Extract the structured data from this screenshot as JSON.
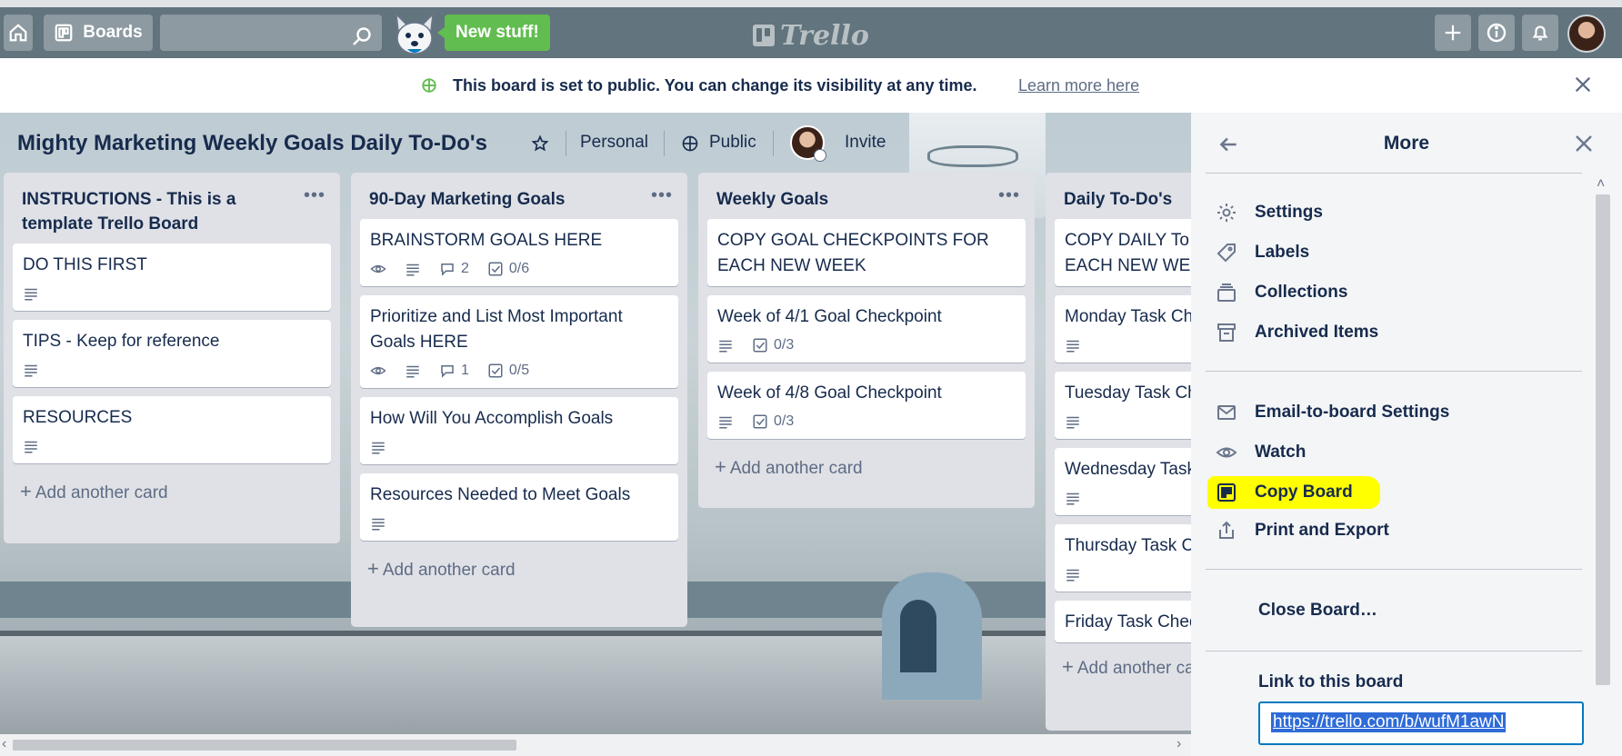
{
  "header": {
    "boards_label": "Boards",
    "search_placeholder": "",
    "new_stuff_label": "New stuff!",
    "logo_text": "Trello"
  },
  "banner": {
    "message": "This board is set to public. You can change its visibility at any time.",
    "learn_more": "Learn more here"
  },
  "board": {
    "title": "Mighty Marketing Weekly Goals Daily To-Do's",
    "team": "Personal",
    "visibility": "Public",
    "invite_label": "Invite"
  },
  "lists": [
    {
      "title": "INSTRUCTIONS - This is a template Trello Board",
      "cards": [
        {
          "title": "DO THIS FIRST"
        },
        {
          "title": "TIPS - Keep for reference"
        },
        {
          "title": "RESOURCES"
        }
      ],
      "add_label": "Add another card"
    },
    {
      "title": "90-Day Marketing Goals",
      "cards": [
        {
          "title": "BRAINSTORM GOALS HERE",
          "comments": "2",
          "checklist": "0/6"
        },
        {
          "title": "Prioritize and List Most Important Goals HERE",
          "comments": "1",
          "checklist": "0/5"
        },
        {
          "title": "How Will You Accomplish Goals"
        },
        {
          "title": "Resources Needed to Meet Goals"
        }
      ],
      "add_label": "Add another card"
    },
    {
      "title": "Weekly Goals",
      "cards": [
        {
          "title": "COPY GOAL CHECKPOINTS FOR EACH NEW WEEK"
        },
        {
          "title": "Week of 4/1 Goal Checkpoint",
          "checklist": "0/3"
        },
        {
          "title": "Week of 4/8 Goal Checkpoint",
          "checklist": "0/3"
        }
      ],
      "add_label": "Add another card"
    },
    {
      "title": "Daily To-Do's",
      "cards": [
        {
          "title": "COPY DAILY To",
          "title2": "EACH NEW WE"
        },
        {
          "title": "Monday Task Ch"
        },
        {
          "title": "Tuesday Task Ch"
        },
        {
          "title": "Wednesday Task"
        },
        {
          "title": "Thursday Task C"
        },
        {
          "title": "Friday Task Chec"
        }
      ],
      "add_label": "Add another ca"
    }
  ],
  "side_menu": {
    "title": "More",
    "group1": [
      "Settings",
      "Labels",
      "Collections",
      "Archived Items"
    ],
    "group2": [
      "Email-to-board Settings",
      "Watch",
      "Copy Board",
      "Print and Export"
    ],
    "close_board": "Close Board…",
    "link_label": "Link to this board",
    "link_value": "https://trello.com/b/wufM1awN"
  },
  "colors": {
    "header": "#5a6c75",
    "new_stuff": "#61bd4f",
    "highlight": "#ffff00",
    "link_border": "#0079bf"
  }
}
